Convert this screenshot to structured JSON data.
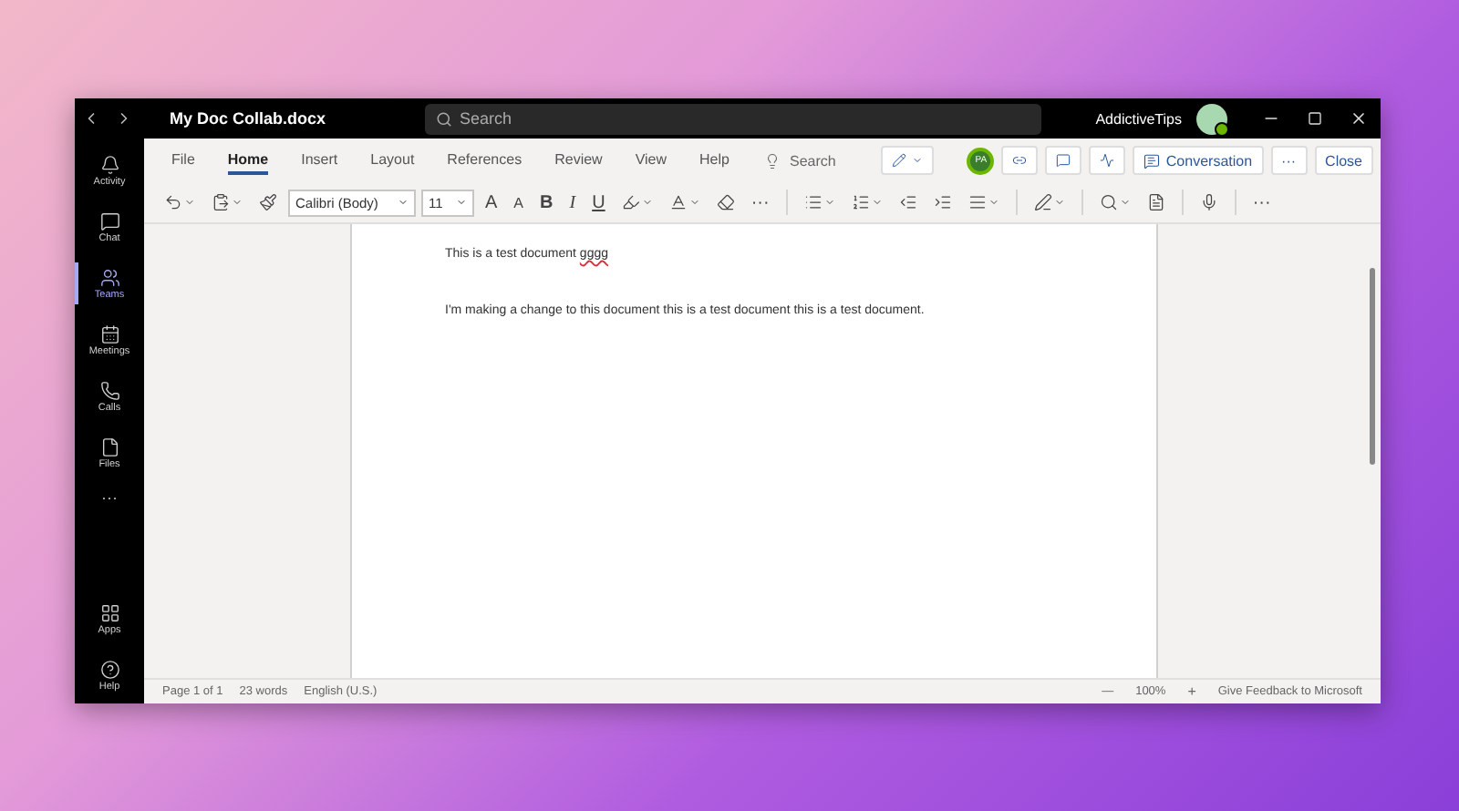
{
  "window": {
    "title": "My Doc Collab.docx",
    "search_placeholder": "Search",
    "account": "AddictiveTips"
  },
  "rail": {
    "items": [
      {
        "label": "Activity",
        "kind": "bell",
        "selected": false
      },
      {
        "label": "Chat",
        "kind": "chat",
        "selected": false
      },
      {
        "label": "Teams",
        "kind": "teams",
        "selected": true
      },
      {
        "label": "Meetings",
        "kind": "calendar",
        "selected": false
      },
      {
        "label": "Calls",
        "kind": "phone",
        "selected": false
      },
      {
        "label": "Files",
        "kind": "file",
        "selected": false
      }
    ],
    "more": "···",
    "bottom": [
      {
        "label": "Apps",
        "kind": "apps",
        "selected": false
      },
      {
        "label": "Help",
        "kind": "help",
        "selected": false
      }
    ]
  },
  "ribbon": {
    "tabs": [
      {
        "label": "File",
        "selected": false
      },
      {
        "label": "Home",
        "selected": true
      },
      {
        "label": "Insert",
        "selected": false
      },
      {
        "label": "Layout",
        "selected": false
      },
      {
        "label": "References",
        "selected": false
      },
      {
        "label": "Review",
        "selected": false
      },
      {
        "label": "View",
        "selected": false
      },
      {
        "label": "Help",
        "selected": false
      }
    ],
    "search": "Search",
    "presence": "PA",
    "conversation": "Conversation",
    "more": "···",
    "close": "Close",
    "font": "Calibri (Body)",
    "size": "11",
    "grow": "A",
    "shrink": "A",
    "bold": "B",
    "italic": "I",
    "underline": "U",
    "more_a": "···",
    "more_b": "···"
  },
  "document": {
    "paragraphs": [
      {
        "text": "This is a test document ",
        "misspelled": "gggg"
      },
      {
        "text": "I'm making a change to this document this is a test document this is a test document."
      }
    ]
  },
  "status_bar": {
    "page": "Page 1 of 1",
    "words": "23 words",
    "language": "English (U.S.)",
    "zoom_out": "—",
    "zoom": "100%",
    "zoom_in": "+",
    "feedback": "Give Feedback to Microsoft"
  }
}
